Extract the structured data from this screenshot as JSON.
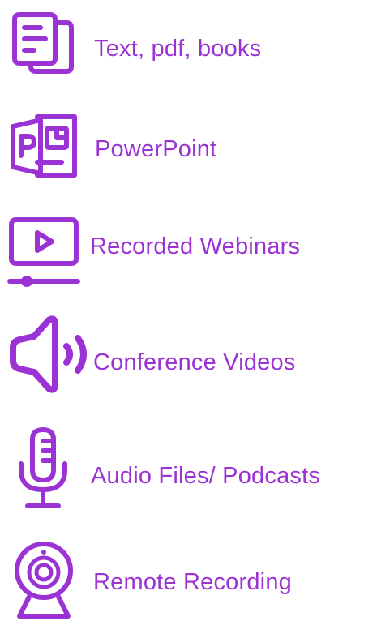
{
  "accent_color": "#9b32d4",
  "items": [
    {
      "icon": "document-icon",
      "label": "Text, pdf, books"
    },
    {
      "icon": "powerpoint-icon",
      "label": "PowerPoint"
    },
    {
      "icon": "video-monitor-icon",
      "label": "Recorded Webinars"
    },
    {
      "icon": "speaker-icon",
      "label": "Conference Videos"
    },
    {
      "icon": "microphone-icon",
      "label": "Audio Files/ Podcasts"
    },
    {
      "icon": "webcam-icon",
      "label": "Remote Recording"
    }
  ]
}
